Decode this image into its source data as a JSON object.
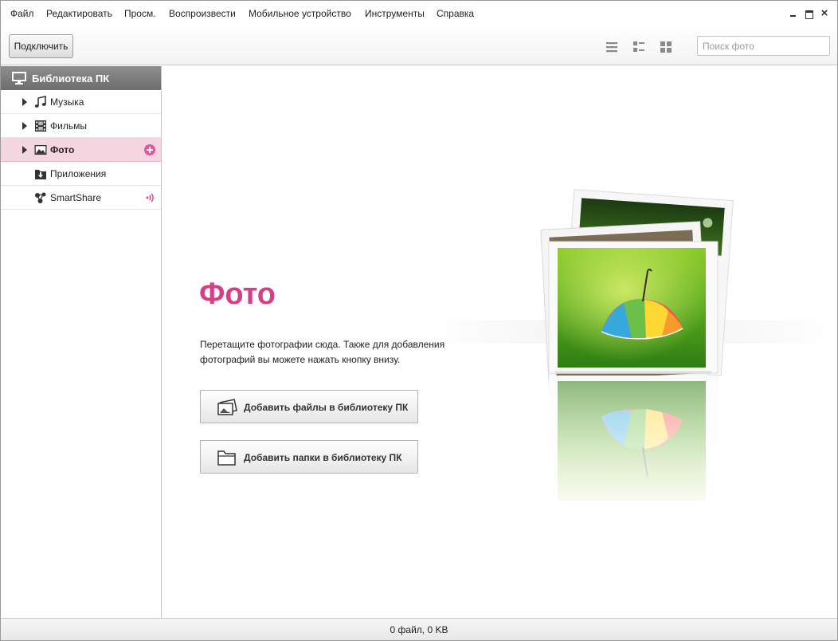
{
  "menu": {
    "items": [
      "Файл",
      "Редактировать",
      "Просм.",
      "Воспроизвести",
      "Мобильное устройство",
      "Инструменты",
      "Справка"
    ]
  },
  "window_controls": {
    "close_glyph": "×"
  },
  "toolbar": {
    "connect_label": "Подключить",
    "search_placeholder": "Поиск фото",
    "view_icons": [
      "list-view-icon",
      "detail-view-icon",
      "grid-view-icon"
    ]
  },
  "sidebar": {
    "header": "Библиотека ПК",
    "items": [
      {
        "label": "Музыка",
        "icon": "music-note-icon",
        "expandable": true,
        "selected": false
      },
      {
        "label": "Фильмы",
        "icon": "film-icon",
        "expandable": true,
        "selected": false
      },
      {
        "label": "Фото",
        "icon": "photo-icon",
        "expandable": true,
        "selected": true,
        "action": "add-icon"
      },
      {
        "label": "Приложения",
        "icon": "app-download-icon",
        "expandable": false,
        "selected": false
      },
      {
        "label": "SmartShare",
        "icon": "smartshare-icon",
        "expandable": false,
        "selected": false,
        "action": "wireless-icon"
      }
    ]
  },
  "main": {
    "title": "Фото",
    "description": "Перетащите фотографии сюда. Также для добавления фотографий вы можете нажать кнопку внизу.",
    "buttons": [
      {
        "label": "Добавить файлы в библиотеку ПК",
        "icon": "add-files-icon"
      },
      {
        "label": "Добавить папки в библиотеку ПК",
        "icon": "folder-icon"
      }
    ]
  },
  "status": {
    "text": "0 файл, 0 KB"
  },
  "colors": {
    "accent": "#d53f86",
    "selected_bg": "#f4d5e0",
    "header_bg": "#7d7d7d"
  }
}
